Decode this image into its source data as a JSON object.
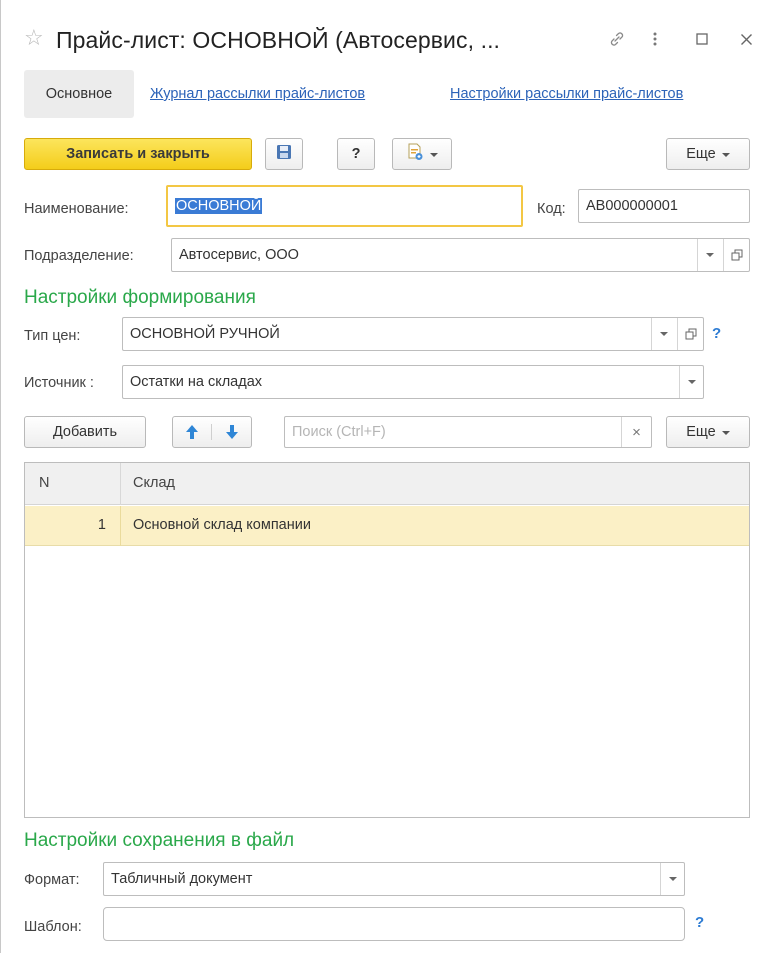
{
  "window": {
    "title": "Прайс-лист: ОСНОВНОЙ (Автосервис, ..."
  },
  "tabs": [
    {
      "label": "Основное",
      "active": true
    },
    {
      "label": "Журнал рассылки прайс-листов"
    },
    {
      "label": "Настройки рассылки прайс-листов"
    }
  ],
  "toolbar": {
    "save_close": "Записать и закрыть",
    "help": "?",
    "more": "Еще"
  },
  "form": {
    "name_label": "Наименование:",
    "name_value": "ОСНОВНОЙ",
    "code_label": "Код:",
    "code_value": "АВ000000001",
    "division_label": "Подразделение:",
    "division_value": "Автосервис, ООО"
  },
  "generation": {
    "heading": "Настройки формирования",
    "price_type_label": "Тип цен:",
    "price_type_value": "ОСНОВНОЙ РУЧНОЙ",
    "source_label": "Источник :",
    "source_value": "Остатки на складах",
    "help": "?"
  },
  "table_toolbar": {
    "add": "Добавить",
    "search_placeholder": "Поиск (Ctrl+F)",
    "clear": "×",
    "more": "Еще"
  },
  "table": {
    "columns": [
      "N",
      "Склад"
    ],
    "rows": [
      {
        "n": "1",
        "warehouse": "Основной склад компании"
      }
    ]
  },
  "file_settings": {
    "heading": "Настройки сохранения в файл",
    "format_label": "Формат:",
    "format_value": "Табличный документ",
    "template_label": "Шаблон:",
    "template_value": "",
    "help": "?"
  },
  "icons": {
    "favorite": "star-icon",
    "link": "link-icon",
    "menu": "more-vertical-icon",
    "maximize": "maximize-icon",
    "close": "close-icon"
  }
}
